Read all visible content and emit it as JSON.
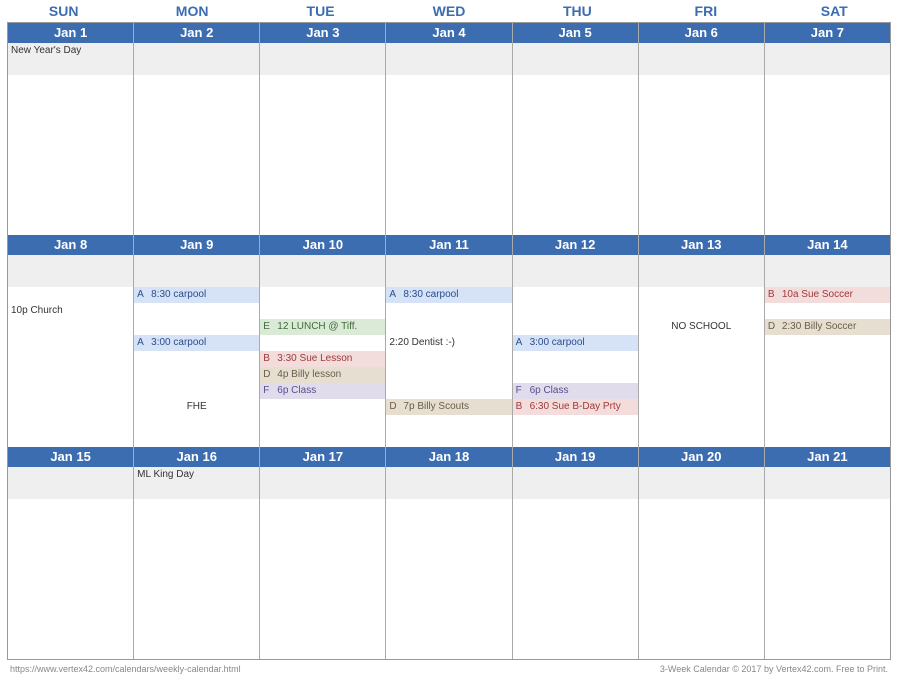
{
  "dow": [
    "SUN",
    "MON",
    "TUE",
    "WED",
    "THU",
    "FRI",
    "SAT"
  ],
  "weeks": [
    {
      "days": [
        {
          "date": "Jan 1",
          "holiday": "New Year's Day",
          "slots": []
        },
        {
          "date": "Jan 2",
          "holiday": "",
          "slots": []
        },
        {
          "date": "Jan 3",
          "holiday": "",
          "slots": []
        },
        {
          "date": "Jan 4",
          "holiday": "",
          "slots": []
        },
        {
          "date": "Jan 5",
          "holiday": "",
          "slots": []
        },
        {
          "date": "Jan 6",
          "holiday": "",
          "slots": []
        },
        {
          "date": "Jan 7",
          "holiday": "",
          "slots": []
        }
      ]
    },
    {
      "days": [
        {
          "date": "Jan 8",
          "holiday": "",
          "slots": [
            {
              "row": 2,
              "cat": "plain",
              "tag": "",
              "text": "10p  Church"
            }
          ]
        },
        {
          "date": "Jan 9",
          "holiday": "",
          "slots": [
            {
              "row": 1,
              "cat": "A",
              "tag": "A",
              "text": "8:30 carpool"
            },
            {
              "row": 4,
              "cat": "A",
              "tag": "A",
              "text": "3:00 carpool"
            },
            {
              "row": 8,
              "cat": "plain",
              "tag": "",
              "text": "FHE",
              "center": true
            }
          ]
        },
        {
          "date": "Jan 10",
          "holiday": "",
          "slots": [
            {
              "row": 3,
              "cat": "E",
              "tag": "E",
              "text": "12 LUNCH @ Tiff."
            },
            {
              "row": 5,
              "cat": "B",
              "tag": "B",
              "text": "3:30 Sue Lesson"
            },
            {
              "row": 6,
              "cat": "D",
              "tag": "D",
              "text": "4p Billy lesson"
            },
            {
              "row": 7,
              "cat": "F",
              "tag": "F",
              "text": "6p Class"
            }
          ]
        },
        {
          "date": "Jan 11",
          "holiday": "",
          "slots": [
            {
              "row": 1,
              "cat": "A",
              "tag": "A",
              "text": "8:30 carpool"
            },
            {
              "row": 4,
              "cat": "plain",
              "tag": "",
              "text": "2:20  Dentist :-)"
            },
            {
              "row": 8,
              "cat": "D",
              "tag": "D",
              "text": "7p Billy Scouts"
            }
          ]
        },
        {
          "date": "Jan 12",
          "holiday": "",
          "slots": [
            {
              "row": 4,
              "cat": "A",
              "tag": "A",
              "text": "3:00 carpool"
            },
            {
              "row": 7,
              "cat": "F",
              "tag": "F",
              "text": "6p Class"
            },
            {
              "row": 8,
              "cat": "B",
              "tag": "B",
              "text": "6:30 Sue B-Day Prty"
            }
          ]
        },
        {
          "date": "Jan 13",
          "holiday": "",
          "slots": [
            {
              "row": 3,
              "cat": "plain",
              "tag": "",
              "text": "NO SCHOOL",
              "center": true
            }
          ]
        },
        {
          "date": "Jan 14",
          "holiday": "",
          "slots": [
            {
              "row": 1,
              "cat": "B",
              "tag": "B",
              "text": "10a Sue Soccer"
            },
            {
              "row": 3,
              "cat": "D",
              "tag": "D",
              "text": "2:30 Billy Soccer"
            }
          ]
        }
      ]
    },
    {
      "days": [
        {
          "date": "Jan 15",
          "holiday": "",
          "slots": []
        },
        {
          "date": "Jan 16",
          "holiday": "ML King Day",
          "slots": []
        },
        {
          "date": "Jan 17",
          "holiday": "",
          "slots": []
        },
        {
          "date": "Jan 18",
          "holiday": "",
          "slots": []
        },
        {
          "date": "Jan 19",
          "holiday": "",
          "slots": []
        },
        {
          "date": "Jan 20",
          "holiday": "",
          "slots": []
        },
        {
          "date": "Jan 21",
          "holiday": "",
          "slots": []
        }
      ]
    }
  ],
  "footer": {
    "left": "https://www.vertex42.com/calendars/weekly-calendar.html",
    "right": "3-Week Calendar © 2017 by Vertex42.com. Free to Print."
  },
  "rows_per_body": 10
}
